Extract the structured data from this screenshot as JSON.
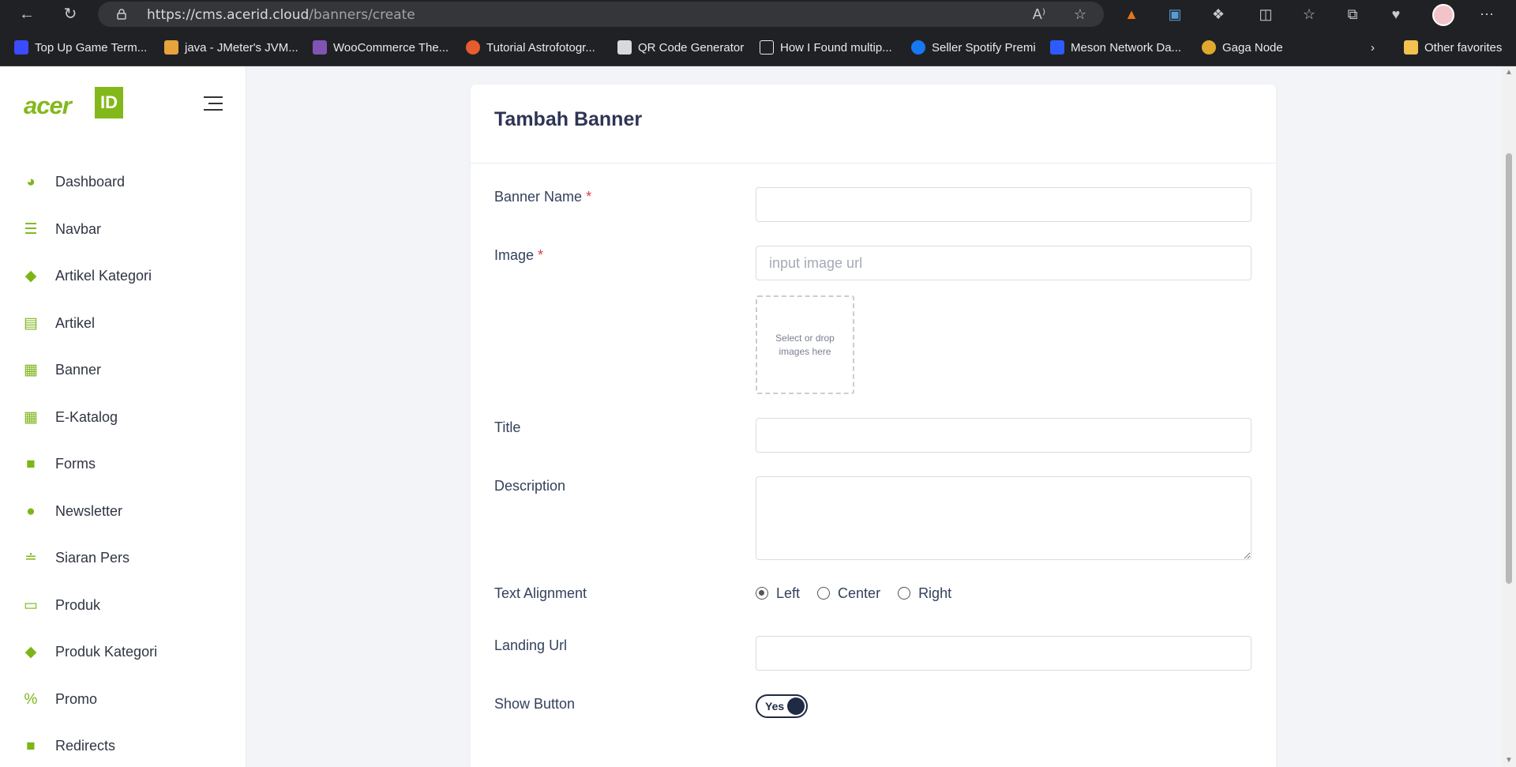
{
  "browser": {
    "url_host": "https://cms.acerid.cloud",
    "url_path": "/banners/create",
    "bookmarks": [
      {
        "label": "Top Up Game Term...",
        "color": "#3b4bff"
      },
      {
        "label": "java - JMeter's JVM...",
        "color": "#e8a33d"
      },
      {
        "label": "WooCommerce The...",
        "color": "#7f54b3"
      },
      {
        "label": "Tutorial Astrofotogr...",
        "color": "#e65c2d"
      },
      {
        "label": "QR Code Generator",
        "color": "#d9d9d9"
      },
      {
        "label": "How I Found multip...",
        "color": "#202124"
      },
      {
        "label": "Seller Spotify Premi",
        "color": "#1877f2"
      },
      {
        "label": "Meson Network Da...",
        "color": "#2e5bff"
      },
      {
        "label": "Gaga Node",
        "color": "#e0a82e"
      }
    ],
    "other_favorites": "Other favorites"
  },
  "sidebar": {
    "logo_text": "acer",
    "logo_badge": "ID",
    "items": [
      {
        "label": "Dashboard",
        "icon": "pie-chart-icon"
      },
      {
        "label": "Navbar",
        "icon": "list-icon"
      },
      {
        "label": "Artikel Kategori",
        "icon": "tag-icon"
      },
      {
        "label": "Artikel",
        "icon": "list-alt-icon"
      },
      {
        "label": "Banner",
        "icon": "images-icon"
      },
      {
        "label": "E-Katalog",
        "icon": "images-icon"
      },
      {
        "label": "Forms",
        "icon": "file-icon"
      },
      {
        "label": "Newsletter",
        "icon": "user-icon"
      },
      {
        "label": "Siaran Pers",
        "icon": "rss-icon"
      },
      {
        "label": "Produk",
        "icon": "laptop-icon"
      },
      {
        "label": "Produk Kategori",
        "icon": "tag-icon"
      },
      {
        "label": "Promo",
        "icon": "percent-icon"
      },
      {
        "label": "Redirects",
        "icon": "file-icon"
      }
    ]
  },
  "form": {
    "title": "Tambah Banner",
    "banner_name_label": "Banner Name",
    "required_mark": "*",
    "image_label": "Image",
    "image_placeholder": "input image url",
    "dropzone_text": "Select or drop images here",
    "title_label": "Title",
    "description_label": "Description",
    "alignment_label": "Text Alignment",
    "alignment_options": [
      "Left",
      "Center",
      "Right"
    ],
    "alignment_selected": "Left",
    "landing_url_label": "Landing Url",
    "show_button_label": "Show Button",
    "show_button_value": "Yes"
  },
  "colors": {
    "accent_green": "#7cb518",
    "title_navy": "#2e3454",
    "toggle_navy": "#1f2a44"
  }
}
